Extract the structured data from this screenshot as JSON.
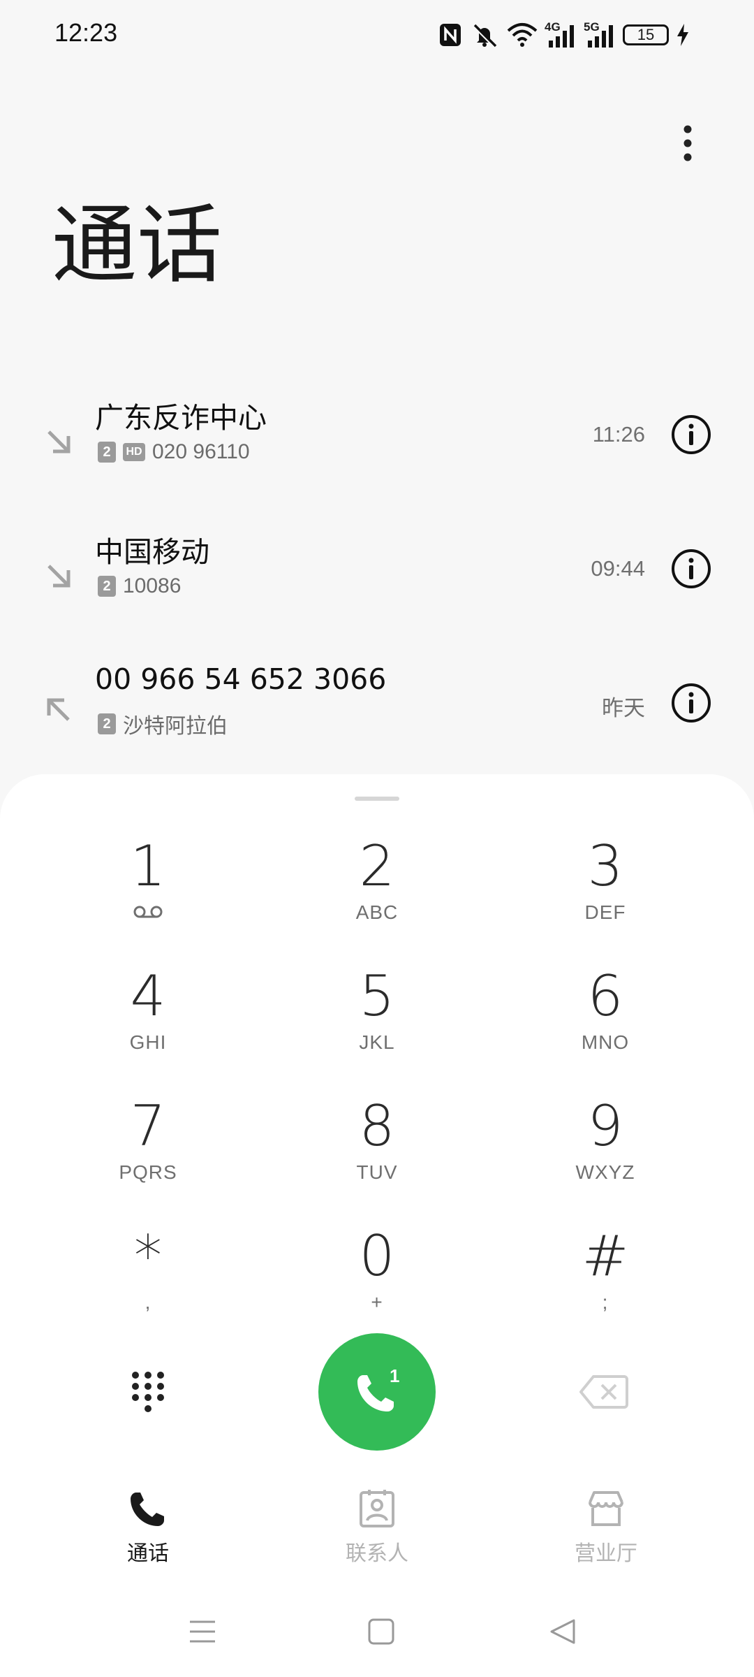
{
  "status_bar": {
    "time": "12:23",
    "net1": "4G",
    "net2": "5G",
    "battery": "15"
  },
  "page": {
    "title": "通话"
  },
  "calls": [
    {
      "name": "广东反诈中心",
      "sim": "2",
      "hd": "HD",
      "number": "020 96110",
      "time": "11:26",
      "direction": "incoming"
    },
    {
      "name": "中国移动",
      "sim": "2",
      "number": "10086",
      "time": "09:44",
      "direction": "incoming"
    },
    {
      "name": "00 966 54 652 3066",
      "sim": "2",
      "location": "沙特阿拉伯",
      "time": "昨天",
      "direction": "outgoing"
    }
  ],
  "dialpad": {
    "keys": [
      {
        "digit": "1",
        "letters": ""
      },
      {
        "digit": "2",
        "letters": "ABC"
      },
      {
        "digit": "3",
        "letters": "DEF"
      },
      {
        "digit": "4",
        "letters": "GHI"
      },
      {
        "digit": "5",
        "letters": "JKL"
      },
      {
        "digit": "6",
        "letters": "MNO"
      },
      {
        "digit": "7",
        "letters": "PQRS"
      },
      {
        "digit": "8",
        "letters": "TUV"
      },
      {
        "digit": "9",
        "letters": "WXYZ"
      },
      {
        "digit": "*",
        "letters": ","
      },
      {
        "digit": "0",
        "letters": "+"
      },
      {
        "digit": "#",
        "letters": ";"
      }
    ],
    "call_sim": "1",
    "call_color": "#33bb57"
  },
  "bottom_nav": {
    "tabs": [
      {
        "label": "通话",
        "active": true
      },
      {
        "label": "联系人",
        "active": false
      },
      {
        "label": "营业厅",
        "active": false
      }
    ]
  }
}
